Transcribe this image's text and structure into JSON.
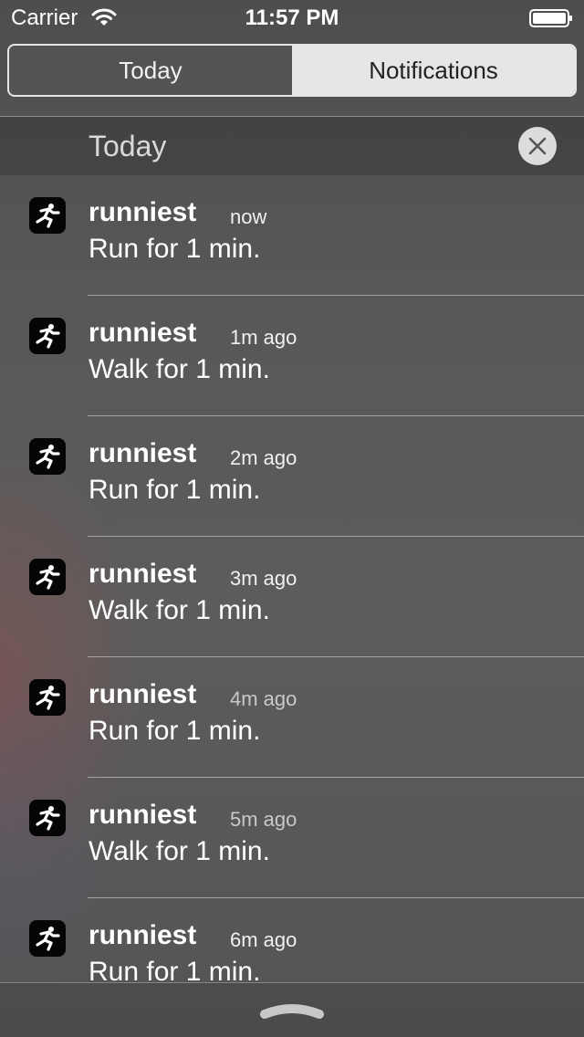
{
  "status_bar": {
    "carrier": "Carrier",
    "time": "11:57 PM",
    "icons": [
      "wifi-icon",
      "battery-icon"
    ]
  },
  "segmented_control": {
    "tabs": [
      {
        "label": "Today",
        "selected": false
      },
      {
        "label": "Notifications",
        "selected": true
      }
    ]
  },
  "section": {
    "title": "Today",
    "clear_icon": "close-icon"
  },
  "notifications": [
    {
      "app": "runniest",
      "time": "now",
      "message": "Run for 1 min."
    },
    {
      "app": "runniest",
      "time": "1m ago",
      "message": "Walk for 1 min."
    },
    {
      "app": "runniest",
      "time": "2m ago",
      "message": "Run for 1 min."
    },
    {
      "app": "runniest",
      "time": "3m ago",
      "message": "Walk for 1 min."
    },
    {
      "app": "runniest",
      "time": "4m ago",
      "message": "Run for 1 min."
    },
    {
      "app": "runniest",
      "time": "5m ago",
      "message": "Walk for 1 min."
    },
    {
      "app": "runniest",
      "time": "6m ago",
      "message": "Run for 1 min."
    }
  ],
  "bottom": {
    "grabber_icon": "chevron-up-icon"
  },
  "colors": {
    "segment_active_bg": "#e6e6e6",
    "app_icon_bg": "#050505"
  }
}
